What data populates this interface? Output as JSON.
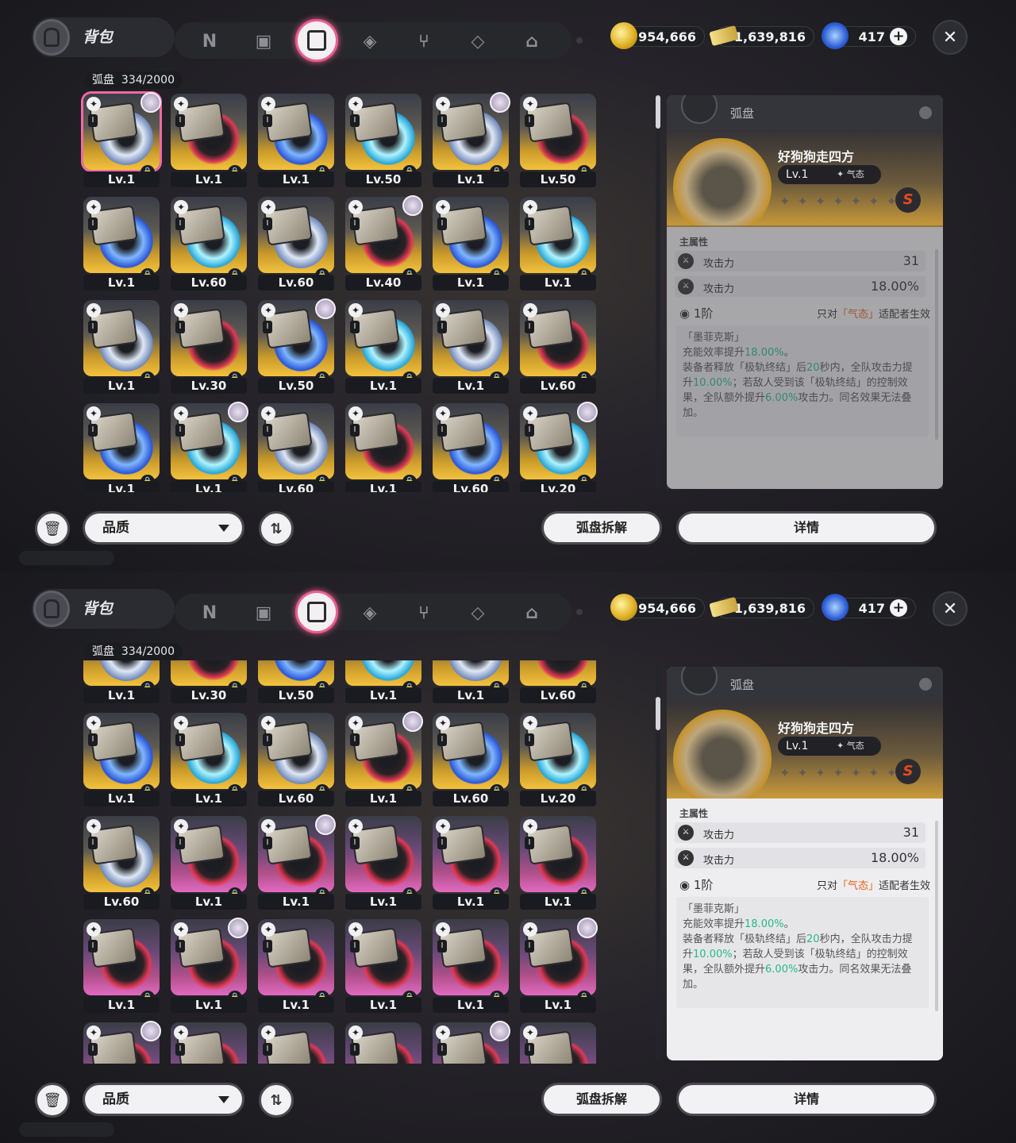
{
  "header": {
    "title": "背包",
    "tabs": [
      "n-icon",
      "gameboy-icon",
      "disc-icon",
      "cube-icon",
      "fork-knife-icon",
      "box-icon",
      "home-icon"
    ],
    "active_tab": "disc-icon"
  },
  "currency": {
    "coins": "954,666",
    "tickets": "1,639,816",
    "gems": "417"
  },
  "inventory": {
    "label": "弧盘",
    "count": "334/2000"
  },
  "detail": {
    "header": "弧盘",
    "name": "好狗狗走四方",
    "level": "Lv.1",
    "attribute": "气态",
    "rank": "S",
    "main_stats_title": "主属性",
    "stats": [
      {
        "name": "攻击力",
        "value": "31"
      },
      {
        "name": "攻击力",
        "value": "18.00%"
      }
    ],
    "tier": "1阶",
    "restrict_prefix": "只对",
    "restrict_attr": "「气态」",
    "restrict_suffix": "适配者生效",
    "effect_title": "「墨菲克斯」",
    "effect_l1a": "充能效率提升",
    "effect_l1b": "18.00%",
    "effect_l1c": "。",
    "effect_l2a": "装备者释放「极轨终结」后",
    "effect_l2b": "20",
    "effect_l2c": "秒内，全队攻击力提升",
    "effect_l2d": "10.00%",
    "effect_l2e": "；若敌人受到该「极轨终结」的控制效果，全队额外提升",
    "effect_l2f": "6.00%",
    "effect_l2g": "攻击力。同名效果无法叠加。"
  },
  "footer": {
    "sort": "品质",
    "disassemble": "弧盘拆解",
    "details": "详情"
  },
  "screen1": {
    "rows": [
      [
        "Lv.1",
        "Lv.1",
        "Lv.1",
        "Lv.50",
        "Lv.1",
        "Lv.50"
      ],
      [
        "Lv.1",
        "Lv.60",
        "Lv.60",
        "Lv.40",
        "Lv.1",
        "Lv.1"
      ],
      [
        "Lv.1",
        "Lv.30",
        "Lv.50",
        "Lv.1",
        "Lv.1",
        "Lv.60"
      ],
      [
        "Lv.1",
        "Lv.1",
        "Lv.60",
        "Lv.1",
        "Lv.60",
        "Lv.20"
      ]
    ]
  },
  "screen2": {
    "rows": [
      [
        "Lv.1",
        "Lv.30",
        "Lv.50",
        "Lv.1",
        "Lv.1",
        "Lv.60"
      ],
      [
        "Lv.1",
        "Lv.1",
        "Lv.60",
        "Lv.1",
        "Lv.60",
        "Lv.20"
      ],
      [
        "Lv.60",
        "Lv.1",
        "Lv.1",
        "Lv.1",
        "Lv.1",
        "Lv.1"
      ],
      [
        "Lv.1",
        "Lv.1",
        "Lv.1",
        "Lv.1",
        "Lv.1",
        "Lv.1"
      ],
      [
        "",
        "",
        "",
        "",
        "",
        ""
      ]
    ]
  }
}
